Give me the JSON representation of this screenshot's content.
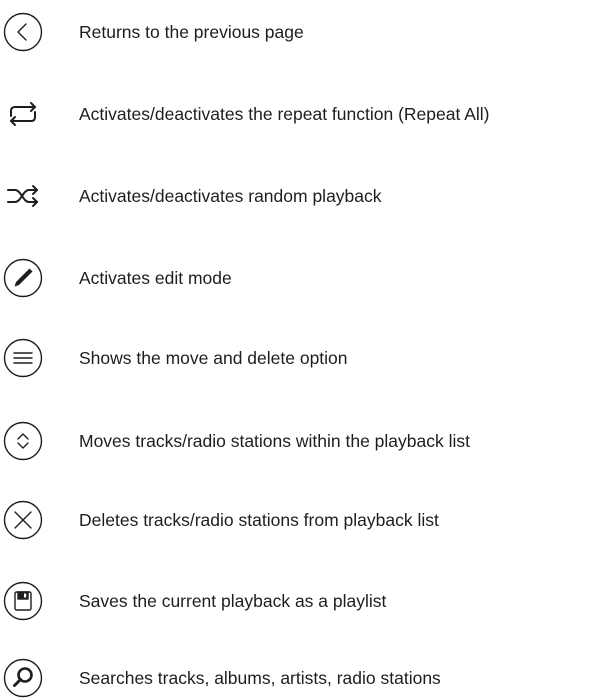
{
  "items": [
    {
      "icon": "back-icon",
      "label": "Returns to the previous page"
    },
    {
      "icon": "repeat-icon",
      "label": "Activates/deactivates the repeat function (Repeat All)"
    },
    {
      "icon": "shuffle-icon",
      "label": "Activates/deactivates random playback"
    },
    {
      "icon": "pencil-icon",
      "label": "Activates edit mode"
    },
    {
      "icon": "menu-icon",
      "label": "Shows the move and delete option"
    },
    {
      "icon": "move-icon",
      "label": "Moves tracks/radio stations within the playback list"
    },
    {
      "icon": "delete-icon",
      "label": "Deletes tracks/radio stations from playback list"
    },
    {
      "icon": "save-icon",
      "label": "Saves the current playback as a playlist"
    },
    {
      "icon": "search-icon",
      "label": "Searches tracks, albums, artists, radio stations"
    }
  ]
}
